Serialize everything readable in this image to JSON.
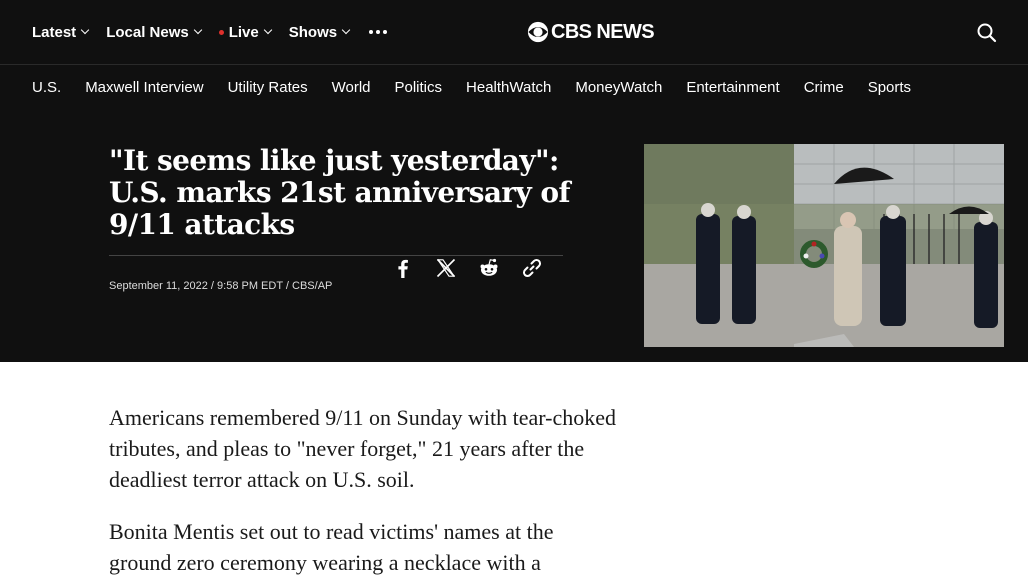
{
  "header": {
    "nav": [
      {
        "label": "Latest",
        "dropdown": true
      },
      {
        "label": "Local News",
        "dropdown": true
      },
      {
        "label": "Live",
        "dropdown": true,
        "live": true
      },
      {
        "label": "Shows",
        "dropdown": true
      }
    ],
    "more_icon": "more-dots-icon",
    "logo_text": "CBS NEWS",
    "search_icon": "search-icon"
  },
  "subnav": [
    "U.S.",
    "Maxwell Interview",
    "Utility Rates",
    "World",
    "Politics",
    "HealthWatch",
    "MoneyWatch",
    "Entertainment",
    "Crime",
    "Sports"
  ],
  "article": {
    "headline": "\"It seems like just yesterday\": U.S. marks 21st anniversary of 9/11 attacks",
    "meta": "September 11, 2022 / 9:58 PM EDT / CBS/AP",
    "share_icons": [
      "facebook-icon",
      "x-icon",
      "reddit-icon",
      "copy-link-icon"
    ],
    "paragraphs": [
      "Americans remembered 9/11 on Sunday with tear-choked tributes, and pleas to \"never forget,\" 21 years after the deadliest terror attack on U.S. soil.",
      "Bonita Mentis set out to read victims' names at the ground zero ceremony wearing a necklace with a"
    ]
  },
  "colors": {
    "dark_bg": "#101010",
    "live_dot": "#e0302c",
    "text_dark": "#1a1a1a"
  }
}
